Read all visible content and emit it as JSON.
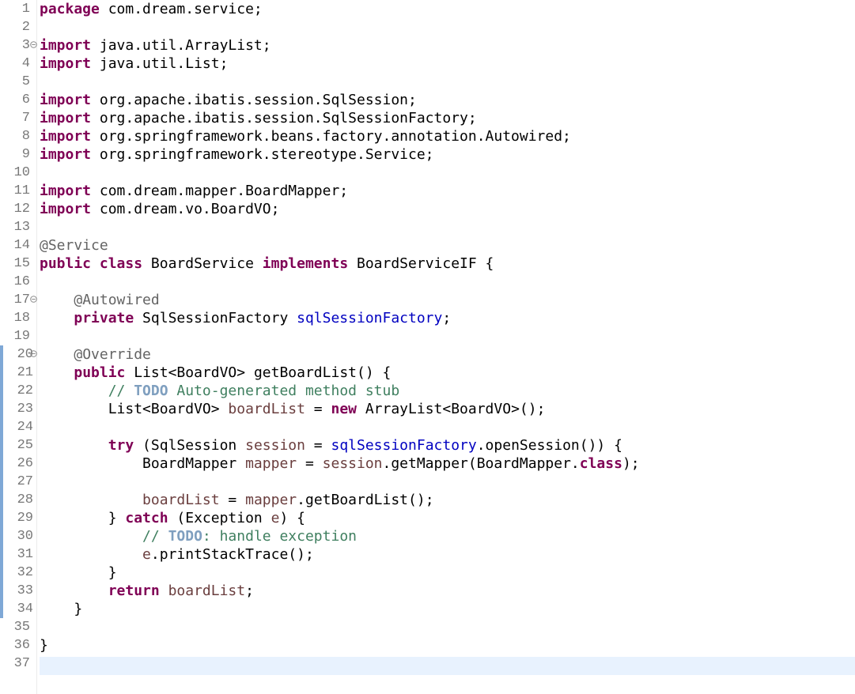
{
  "editor": {
    "language": "java",
    "current_line": 37,
    "colors": {
      "keyword": "#7f0055",
      "annotation": "#646464",
      "field": "#0000c0",
      "local_variable": "#6a3e3e",
      "comment": "#3f7f5f",
      "task_tag": "#7f9fbf",
      "default": "#000000",
      "line_number": "#787878",
      "current_line_bg": "#e8f2fe",
      "change_marker": "#7fa8d6"
    },
    "fold_icon": "collapse-minus-icon",
    "lines": [
      {
        "num": "1",
        "tokens": [
          {
            "t": "package",
            "c": "kw"
          },
          {
            "t": " com.dream.service;",
            "c": "tx"
          }
        ]
      },
      {
        "num": "2",
        "tokens": []
      },
      {
        "num": "3",
        "fold": true,
        "tokens": [
          {
            "t": "import",
            "c": "kw"
          },
          {
            "t": " java.util.ArrayList;",
            "c": "tx"
          }
        ]
      },
      {
        "num": "4",
        "tokens": [
          {
            "t": "import",
            "c": "kw"
          },
          {
            "t": " java.util.List;",
            "c": "tx"
          }
        ]
      },
      {
        "num": "5",
        "tokens": []
      },
      {
        "num": "6",
        "tokens": [
          {
            "t": "import",
            "c": "kw"
          },
          {
            "t": " org.apache.ibatis.session.SqlSession;",
            "c": "tx"
          }
        ]
      },
      {
        "num": "7",
        "tokens": [
          {
            "t": "import",
            "c": "kw"
          },
          {
            "t": " org.apache.ibatis.session.SqlSessionFactory;",
            "c": "tx"
          }
        ]
      },
      {
        "num": "8",
        "tokens": [
          {
            "t": "import",
            "c": "kw"
          },
          {
            "t": " org.springframework.beans.factory.annotation.Autowired;",
            "c": "tx"
          }
        ]
      },
      {
        "num": "9",
        "tokens": [
          {
            "t": "import",
            "c": "kw"
          },
          {
            "t": " org.springframework.stereotype.Service;",
            "c": "tx"
          }
        ]
      },
      {
        "num": "10",
        "tokens": []
      },
      {
        "num": "11",
        "tokens": [
          {
            "t": "import",
            "c": "kw"
          },
          {
            "t": " com.dream.mapper.BoardMapper;",
            "c": "tx"
          }
        ]
      },
      {
        "num": "12",
        "tokens": [
          {
            "t": "import",
            "c": "kw"
          },
          {
            "t": " com.dream.vo.BoardVO;",
            "c": "tx"
          }
        ]
      },
      {
        "num": "13",
        "tokens": []
      },
      {
        "num": "14",
        "tokens": [
          {
            "t": "@Service",
            "c": "ann"
          }
        ]
      },
      {
        "num": "15",
        "tokens": [
          {
            "t": "public",
            "c": "kw"
          },
          {
            "t": " ",
            "c": "tx"
          },
          {
            "t": "class",
            "c": "kw"
          },
          {
            "t": " BoardService ",
            "c": "tx"
          },
          {
            "t": "implements",
            "c": "kw"
          },
          {
            "t": " BoardServiceIF {",
            "c": "tx"
          }
        ]
      },
      {
        "num": "16",
        "tokens": []
      },
      {
        "num": "17",
        "fold": true,
        "tokens": [
          {
            "t": "    ",
            "c": "tx"
          },
          {
            "t": "@Autowired",
            "c": "ann"
          }
        ]
      },
      {
        "num": "18",
        "tokens": [
          {
            "t": "    ",
            "c": "tx"
          },
          {
            "t": "private",
            "c": "kw"
          },
          {
            "t": " SqlSessionFactory ",
            "c": "tx"
          },
          {
            "t": "sqlSessionFactory",
            "c": "fld"
          },
          {
            "t": ";",
            "c": "tx"
          }
        ]
      },
      {
        "num": "19",
        "tokens": []
      },
      {
        "num": "20",
        "fold": true,
        "marked": true,
        "tokens": [
          {
            "t": "    ",
            "c": "tx"
          },
          {
            "t": "@Override",
            "c": "ann"
          }
        ]
      },
      {
        "num": "21",
        "marked": true,
        "tokens": [
          {
            "t": "    ",
            "c": "tx"
          },
          {
            "t": "public",
            "c": "kw"
          },
          {
            "t": " List<BoardVO> getBoardList() {",
            "c": "tx"
          }
        ]
      },
      {
        "num": "22",
        "marked": true,
        "tokens": [
          {
            "t": "        ",
            "c": "tx"
          },
          {
            "t": "// ",
            "c": "cmt"
          },
          {
            "t": "TODO",
            "c": "todo"
          },
          {
            "t": " Auto-generated method stub",
            "c": "cmt"
          }
        ]
      },
      {
        "num": "23",
        "marked": true,
        "tokens": [
          {
            "t": "        List<BoardVO> ",
            "c": "tx"
          },
          {
            "t": "boardList",
            "c": "var"
          },
          {
            "t": " = ",
            "c": "tx"
          },
          {
            "t": "new",
            "c": "kw"
          },
          {
            "t": " ArrayList<BoardVO>();",
            "c": "tx"
          }
        ]
      },
      {
        "num": "24",
        "marked": true,
        "tokens": []
      },
      {
        "num": "25",
        "marked": true,
        "tokens": [
          {
            "t": "        ",
            "c": "tx"
          },
          {
            "t": "try",
            "c": "kw"
          },
          {
            "t": " (SqlSession ",
            "c": "tx"
          },
          {
            "t": "session",
            "c": "var"
          },
          {
            "t": " = ",
            "c": "tx"
          },
          {
            "t": "sqlSessionFactory",
            "c": "fld"
          },
          {
            "t": ".openSession()) {",
            "c": "tx"
          }
        ]
      },
      {
        "num": "26",
        "marked": true,
        "tokens": [
          {
            "t": "            BoardMapper ",
            "c": "tx"
          },
          {
            "t": "mapper",
            "c": "var"
          },
          {
            "t": " = ",
            "c": "tx"
          },
          {
            "t": "session",
            "c": "var"
          },
          {
            "t": ".getMapper(BoardMapper.",
            "c": "tx"
          },
          {
            "t": "class",
            "c": "kw"
          },
          {
            "t": ");",
            "c": "tx"
          }
        ]
      },
      {
        "num": "27",
        "marked": true,
        "tokens": []
      },
      {
        "num": "28",
        "marked": true,
        "tokens": [
          {
            "t": "            ",
            "c": "tx"
          },
          {
            "t": "boardList",
            "c": "var"
          },
          {
            "t": " = ",
            "c": "tx"
          },
          {
            "t": "mapper",
            "c": "var"
          },
          {
            "t": ".getBoardList();",
            "c": "tx"
          }
        ]
      },
      {
        "num": "29",
        "marked": true,
        "tokens": [
          {
            "t": "        } ",
            "c": "tx"
          },
          {
            "t": "catch",
            "c": "kw"
          },
          {
            "t": " (Exception ",
            "c": "tx"
          },
          {
            "t": "e",
            "c": "var"
          },
          {
            "t": ") {",
            "c": "tx"
          }
        ]
      },
      {
        "num": "30",
        "marked": true,
        "tokens": [
          {
            "t": "            ",
            "c": "tx"
          },
          {
            "t": "// ",
            "c": "cmt"
          },
          {
            "t": "TODO",
            "c": "todo"
          },
          {
            "t": ": handle exception",
            "c": "cmt"
          }
        ]
      },
      {
        "num": "31",
        "marked": true,
        "tokens": [
          {
            "t": "            ",
            "c": "tx"
          },
          {
            "t": "e",
            "c": "var"
          },
          {
            "t": ".printStackTrace();",
            "c": "tx"
          }
        ]
      },
      {
        "num": "32",
        "marked": true,
        "tokens": [
          {
            "t": "        }",
            "c": "tx"
          }
        ]
      },
      {
        "num": "33",
        "marked": true,
        "tokens": [
          {
            "t": "        ",
            "c": "tx"
          },
          {
            "t": "return",
            "c": "kw"
          },
          {
            "t": " ",
            "c": "tx"
          },
          {
            "t": "boardList",
            "c": "var"
          },
          {
            "t": ";",
            "c": "tx"
          }
        ]
      },
      {
        "num": "34",
        "marked": true,
        "tokens": [
          {
            "t": "    }",
            "c": "tx"
          }
        ]
      },
      {
        "num": "35",
        "tokens": []
      },
      {
        "num": "36",
        "tokens": [
          {
            "t": "}",
            "c": "tx"
          }
        ]
      },
      {
        "num": "37",
        "tokens": []
      }
    ]
  }
}
